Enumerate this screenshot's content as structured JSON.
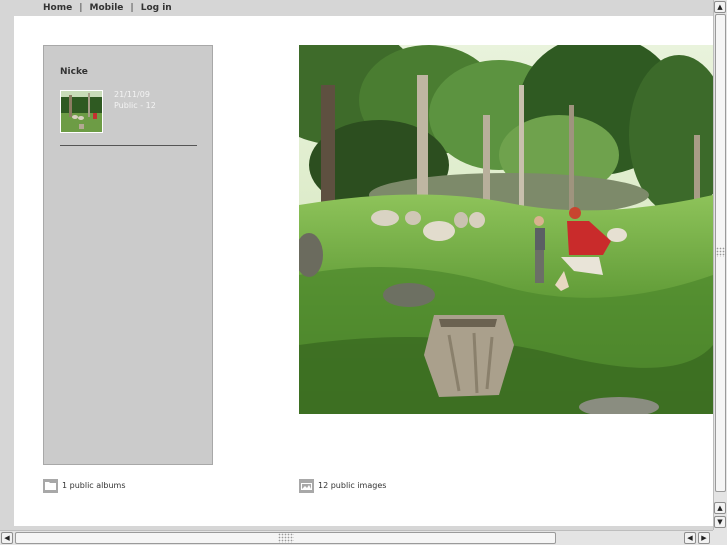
{
  "nav": {
    "home": "Home",
    "mobile": "Mobile",
    "login": "Log in",
    "separator": "|"
  },
  "album": {
    "owner": "Nicke",
    "date": "21/11/09",
    "visibility": "Public - 12"
  },
  "stats": {
    "albums": "1 public albums",
    "images": "12 public images"
  },
  "icons": {
    "album": "folder-icon",
    "images": "image-stack-icon"
  },
  "colors": {
    "page_bg": "#d6d6d6",
    "panel_bg": "#cbcbcb",
    "content_bg": "#ffffff"
  }
}
